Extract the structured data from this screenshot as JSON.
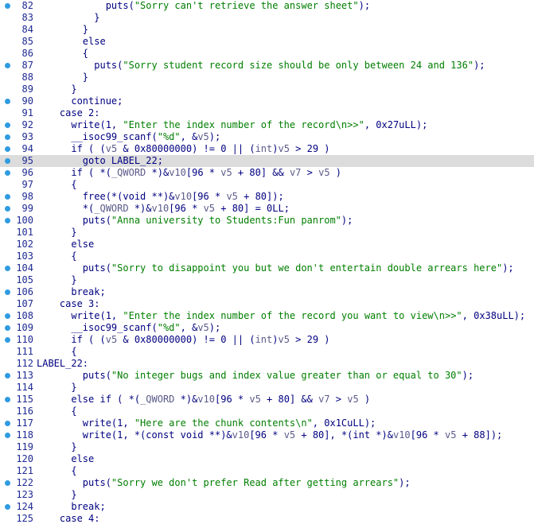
{
  "lines": [
    {
      "n": "82",
      "dot": true,
      "hl": false,
      "indent": 12,
      "toks": [
        [
          "pl",
          "puts("
        ],
        [
          "str",
          "\"Sorry can't retrieve the answer sheet\""
        ],
        [
          "pl",
          ");"
        ]
      ]
    },
    {
      "n": "83",
      "dot": false,
      "hl": false,
      "indent": 10,
      "toks": [
        [
          "pl",
          "}"
        ]
      ]
    },
    {
      "n": "84",
      "dot": false,
      "hl": false,
      "indent": 8,
      "toks": [
        [
          "pl",
          "}"
        ]
      ]
    },
    {
      "n": "85",
      "dot": false,
      "hl": false,
      "indent": 8,
      "toks": [
        [
          "pl",
          "else"
        ]
      ]
    },
    {
      "n": "86",
      "dot": false,
      "hl": false,
      "indent": 8,
      "toks": [
        [
          "pl",
          "{"
        ]
      ]
    },
    {
      "n": "87",
      "dot": true,
      "hl": false,
      "indent": 10,
      "toks": [
        [
          "pl",
          "puts("
        ],
        [
          "str",
          "\"Sorry student record size should be only between 24 and 136\""
        ],
        [
          "pl",
          ");"
        ]
      ]
    },
    {
      "n": "88",
      "dot": false,
      "hl": false,
      "indent": 8,
      "toks": [
        [
          "pl",
          "}"
        ]
      ]
    },
    {
      "n": "89",
      "dot": false,
      "hl": false,
      "indent": 6,
      "toks": [
        [
          "pl",
          "}"
        ]
      ]
    },
    {
      "n": "90",
      "dot": true,
      "hl": false,
      "indent": 6,
      "toks": [
        [
          "pl",
          "continue;"
        ]
      ]
    },
    {
      "n": "91",
      "dot": false,
      "hl": false,
      "indent": 4,
      "toks": [
        [
          "pl",
          "case 2:"
        ]
      ]
    },
    {
      "n": "92",
      "dot": true,
      "hl": false,
      "indent": 6,
      "toks": [
        [
          "pl",
          "write(1, "
        ],
        [
          "str",
          "\"Enter the index number of the record\\n>>\""
        ],
        [
          "pl",
          ", 0x27uLL);"
        ]
      ]
    },
    {
      "n": "93",
      "dot": true,
      "hl": false,
      "indent": 6,
      "toks": [
        [
          "pl",
          "__isoc99_scanf("
        ],
        [
          "str",
          "\"%d\""
        ],
        [
          "pl",
          ", &"
        ],
        [
          "var",
          "v5"
        ],
        [
          "pl",
          ");"
        ]
      ]
    },
    {
      "n": "94",
      "dot": true,
      "hl": false,
      "indent": 6,
      "toks": [
        [
          "pl",
          "if ( ("
        ],
        [
          "var",
          "v5"
        ],
        [
          "pl",
          " & 0x80000000) != 0 || ("
        ],
        [
          "var",
          "int"
        ],
        [
          "pl",
          ")"
        ],
        [
          "var",
          "v5"
        ],
        [
          "pl",
          " > 29 )"
        ]
      ]
    },
    {
      "n": "95",
      "dot": true,
      "hl": true,
      "indent": 8,
      "toks": [
        [
          "pl",
          "goto LABEL_22;"
        ]
      ]
    },
    {
      "n": "96",
      "dot": true,
      "hl": false,
      "indent": 6,
      "toks": [
        [
          "pl",
          "if ( *("
        ],
        [
          "var",
          "_QWORD"
        ],
        [
          "pl",
          " *)&"
        ],
        [
          "var",
          "v10"
        ],
        [
          "pl",
          "[96 * "
        ],
        [
          "var",
          "v5"
        ],
        [
          "pl",
          " + 80] && "
        ],
        [
          "var",
          "v7"
        ],
        [
          "pl",
          " > "
        ],
        [
          "var",
          "v5"
        ],
        [
          "pl",
          " )"
        ]
      ]
    },
    {
      "n": "97",
      "dot": false,
      "hl": false,
      "indent": 6,
      "toks": [
        [
          "pl",
          "{"
        ]
      ]
    },
    {
      "n": "98",
      "dot": true,
      "hl": false,
      "indent": 8,
      "toks": [
        [
          "pl",
          "free(*(void **)&"
        ],
        [
          "var",
          "v10"
        ],
        [
          "pl",
          "[96 * "
        ],
        [
          "var",
          "v5"
        ],
        [
          "pl",
          " + 80]);"
        ]
      ]
    },
    {
      "n": "99",
      "dot": true,
      "hl": false,
      "indent": 8,
      "toks": [
        [
          "pl",
          "*("
        ],
        [
          "var",
          "_QWORD"
        ],
        [
          "pl",
          " *)&"
        ],
        [
          "var",
          "v10"
        ],
        [
          "pl",
          "[96 * "
        ],
        [
          "var",
          "v5"
        ],
        [
          "pl",
          " + 80] = 0LL;"
        ]
      ]
    },
    {
      "n": "100",
      "dot": true,
      "hl": false,
      "indent": 8,
      "toks": [
        [
          "pl",
          "puts("
        ],
        [
          "str",
          "\"Anna university to Students:Fun panrom\""
        ],
        [
          "pl",
          ");"
        ]
      ]
    },
    {
      "n": "101",
      "dot": false,
      "hl": false,
      "indent": 6,
      "toks": [
        [
          "pl",
          "}"
        ]
      ]
    },
    {
      "n": "102",
      "dot": false,
      "hl": false,
      "indent": 6,
      "toks": [
        [
          "pl",
          "else"
        ]
      ]
    },
    {
      "n": "103",
      "dot": false,
      "hl": false,
      "indent": 6,
      "toks": [
        [
          "pl",
          "{"
        ]
      ]
    },
    {
      "n": "104",
      "dot": true,
      "hl": false,
      "indent": 8,
      "toks": [
        [
          "pl",
          "puts("
        ],
        [
          "str",
          "\"Sorry to disappoint you but we don't entertain double arrears here\""
        ],
        [
          "pl",
          ");"
        ]
      ]
    },
    {
      "n": "105",
      "dot": false,
      "hl": false,
      "indent": 6,
      "toks": [
        [
          "pl",
          "}"
        ]
      ]
    },
    {
      "n": "106",
      "dot": true,
      "hl": false,
      "indent": 6,
      "toks": [
        [
          "pl",
          "break;"
        ]
      ]
    },
    {
      "n": "107",
      "dot": false,
      "hl": false,
      "indent": 4,
      "toks": [
        [
          "pl",
          "case 3:"
        ]
      ]
    },
    {
      "n": "108",
      "dot": true,
      "hl": false,
      "indent": 6,
      "toks": [
        [
          "pl",
          "write(1, "
        ],
        [
          "str",
          "\"Enter the index number of the record you want to view\\n>>\""
        ],
        [
          "pl",
          ", 0x38uLL);"
        ]
      ]
    },
    {
      "n": "109",
      "dot": true,
      "hl": false,
      "indent": 6,
      "toks": [
        [
          "pl",
          "__isoc99_scanf("
        ],
        [
          "str",
          "\"%d\""
        ],
        [
          "pl",
          ", &"
        ],
        [
          "var",
          "v5"
        ],
        [
          "pl",
          ");"
        ]
      ]
    },
    {
      "n": "110",
      "dot": true,
      "hl": false,
      "indent": 6,
      "toks": [
        [
          "pl",
          "if ( ("
        ],
        [
          "var",
          "v5"
        ],
        [
          "pl",
          " & 0x80000000) != 0 || ("
        ],
        [
          "var",
          "int"
        ],
        [
          "pl",
          ")"
        ],
        [
          "var",
          "v5"
        ],
        [
          "pl",
          " > 29 )"
        ]
      ]
    },
    {
      "n": "111",
      "dot": false,
      "hl": false,
      "indent": 6,
      "toks": [
        [
          "pl",
          "{"
        ]
      ]
    },
    {
      "n": "112",
      "dot": false,
      "hl": false,
      "indent": 0,
      "label": "LABEL_22:",
      "toks": []
    },
    {
      "n": "113",
      "dot": true,
      "hl": false,
      "indent": 8,
      "toks": [
        [
          "pl",
          "puts("
        ],
        [
          "str",
          "\"No integer bugs and index value greater than or equal to 30\""
        ],
        [
          "pl",
          ");"
        ]
      ]
    },
    {
      "n": "114",
      "dot": false,
      "hl": false,
      "indent": 6,
      "toks": [
        [
          "pl",
          "}"
        ]
      ]
    },
    {
      "n": "115",
      "dot": true,
      "hl": false,
      "indent": 6,
      "toks": [
        [
          "pl",
          "else if ( *("
        ],
        [
          "var",
          "_QWORD"
        ],
        [
          "pl",
          " *)&"
        ],
        [
          "var",
          "v10"
        ],
        [
          "pl",
          "[96 * "
        ],
        [
          "var",
          "v5"
        ],
        [
          "pl",
          " + 80] && "
        ],
        [
          "var",
          "v7"
        ],
        [
          "pl",
          " > "
        ],
        [
          "var",
          "v5"
        ],
        [
          "pl",
          " )"
        ]
      ]
    },
    {
      "n": "116",
      "dot": false,
      "hl": false,
      "indent": 6,
      "toks": [
        [
          "pl",
          "{"
        ]
      ]
    },
    {
      "n": "117",
      "dot": true,
      "hl": false,
      "indent": 8,
      "toks": [
        [
          "pl",
          "write(1, "
        ],
        [
          "str",
          "\"Here are the chunk contents\\n\""
        ],
        [
          "pl",
          ", 0x1CuLL);"
        ]
      ]
    },
    {
      "n": "118",
      "dot": true,
      "hl": false,
      "indent": 8,
      "toks": [
        [
          "pl",
          "write(1, *(const void **)&"
        ],
        [
          "var",
          "v10"
        ],
        [
          "pl",
          "[96 * "
        ],
        [
          "var",
          "v5"
        ],
        [
          "pl",
          " + 80], *(int *)&"
        ],
        [
          "var",
          "v10"
        ],
        [
          "pl",
          "[96 * "
        ],
        [
          "var",
          "v5"
        ],
        [
          "pl",
          " + 88]);"
        ]
      ]
    },
    {
      "n": "119",
      "dot": false,
      "hl": false,
      "indent": 6,
      "toks": [
        [
          "pl",
          "}"
        ]
      ]
    },
    {
      "n": "120",
      "dot": false,
      "hl": false,
      "indent": 6,
      "toks": [
        [
          "pl",
          "else"
        ]
      ]
    },
    {
      "n": "121",
      "dot": false,
      "hl": false,
      "indent": 6,
      "toks": [
        [
          "pl",
          "{"
        ]
      ]
    },
    {
      "n": "122",
      "dot": true,
      "hl": false,
      "indent": 8,
      "toks": [
        [
          "pl",
          "puts("
        ],
        [
          "str",
          "\"Sorry we don't prefer Read after getting arrears\""
        ],
        [
          "pl",
          ");"
        ]
      ]
    },
    {
      "n": "123",
      "dot": false,
      "hl": false,
      "indent": 6,
      "toks": [
        [
          "pl",
          "}"
        ]
      ]
    },
    {
      "n": "124",
      "dot": true,
      "hl": false,
      "indent": 6,
      "toks": [
        [
          "pl",
          "break;"
        ]
      ]
    },
    {
      "n": "125",
      "dot": false,
      "hl": false,
      "indent": 4,
      "toks": [
        [
          "pl",
          "case 4:"
        ]
      ]
    }
  ],
  "colors": {
    "string": "#007e00",
    "plain": "#000080",
    "variable": "#5a5a8a",
    "line_number": "#1e2a92",
    "breakpoint_dot": "#2f9be0",
    "highlight": "#dcdcdc"
  }
}
